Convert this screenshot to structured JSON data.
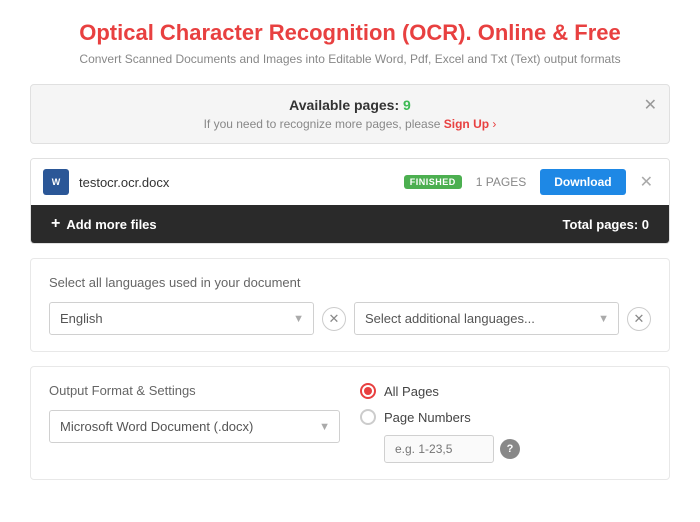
{
  "page": {
    "title": "Optical Character Recognition (OCR). Online & Free",
    "subtitle": "Convert Scanned Documents and Images into Editable Word, Pdf, Excel and Txt (Text) output formats"
  },
  "available_panel": {
    "label": "Available pages:",
    "count": "9",
    "signup_prompt": "If you need to recognize more pages, please",
    "signup_label": "Sign Up",
    "signup_arrow": "›"
  },
  "file": {
    "icon_text": "W",
    "name": "testocr.ocr.docx",
    "status": "FINISHED",
    "pages": "1 PAGES",
    "download_label": "Download"
  },
  "add_files": {
    "plus": "+",
    "label": "Add more files",
    "total_label": "Total pages: 0"
  },
  "language_section": {
    "label": "Select all languages used in your document",
    "primary_placeholder": "English",
    "secondary_placeholder": "Select additional languages..."
  },
  "output_section": {
    "label": "Output Format & Settings",
    "format_placeholder": "Microsoft Word Document (.docx)",
    "radio_all_pages": "All Pages",
    "radio_page_numbers": "Page Numbers",
    "page_numbers_placeholder": "e.g. 1-23,5",
    "help": "?"
  }
}
